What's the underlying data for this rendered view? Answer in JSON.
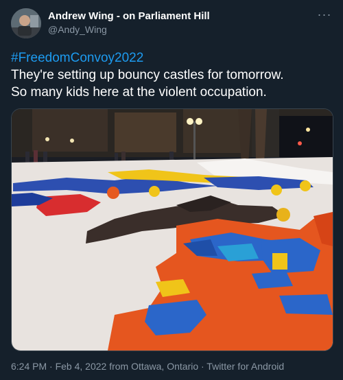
{
  "author": {
    "display_name": "Andrew Wing - on Parliament Hill",
    "handle": "@Andy_Wing"
  },
  "tweet": {
    "hashtag": "#FreedomConvoy2022",
    "line1": "They're setting up bouncy castles for tomorrow.",
    "line2": "So many kids here at the violent occupation."
  },
  "metadata": {
    "timestamp": "6:24 PM · Feb 4, 2022 from Ottawa, Ontario · Twitter for Android"
  },
  "icons": {
    "more": "more-horizontal-icon"
  },
  "colors": {
    "background": "#15202b",
    "link": "#1d9bf0",
    "secondary_text": "#8b98a5"
  }
}
